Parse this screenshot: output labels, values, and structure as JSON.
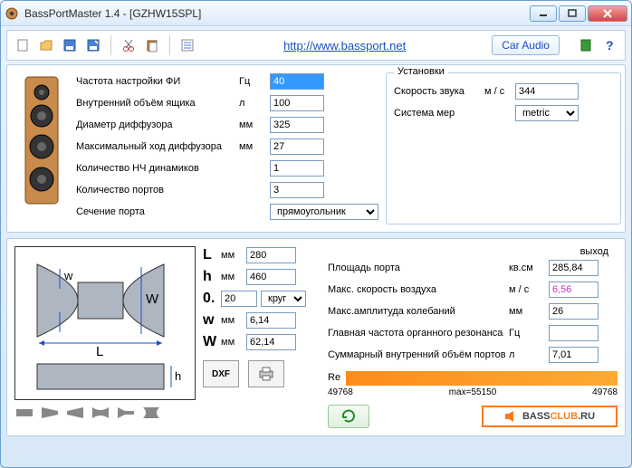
{
  "window": {
    "title": "BassPortMaster 1.4  - [GZHW15SPL]"
  },
  "toolbar": {
    "link": "http://www.bassport.net",
    "car_audio": "Car Audio"
  },
  "params": {
    "freq": {
      "label": "Частота настройки ФИ",
      "unit": "Гц",
      "value": "40"
    },
    "volume": {
      "label": "Внутренний объём ящика",
      "unit": "л",
      "value": "100"
    },
    "diameter": {
      "label": "Диаметр диффузора",
      "unit": "мм",
      "value": "325"
    },
    "xmax": {
      "label": "Максимальный ход диффузора",
      "unit": "мм",
      "value": "27"
    },
    "drivers": {
      "label": "Количество НЧ динамиков",
      "unit": "",
      "value": "1"
    },
    "ports": {
      "label": "Количество портов",
      "unit": "",
      "value": "3"
    },
    "section": {
      "label": "Сечение порта",
      "unit": "",
      "value": "прямоугольник"
    }
  },
  "settings": {
    "legend": "Установки",
    "sound_speed": {
      "label": "Скорость звука",
      "unit": "м / с",
      "value": "344"
    },
    "system": {
      "label": "Система мер",
      "unit": "",
      "value": "metric"
    }
  },
  "dims": {
    "L": {
      "label": "L",
      "unit": "мм",
      "value": "280"
    },
    "h": {
      "label": "h",
      "unit": "мм",
      "value": "460"
    },
    "O": {
      "label": "0.",
      "value": "20",
      "shape": "круг"
    },
    "w": {
      "label": "w",
      "unit": "мм",
      "value": "6,14"
    },
    "W": {
      "label": "W",
      "unit": "мм",
      "value": "62,14"
    }
  },
  "buttons": {
    "dxf": "DXF"
  },
  "output": {
    "header": "выход",
    "area": {
      "label": "Площадь порта",
      "unit": "кв.см",
      "value": "285,84"
    },
    "velocity": {
      "label": "Макс. скорость воздуха",
      "unit": "м / с",
      "value": "6,56"
    },
    "amp": {
      "label": "Макс.амплитуда колебаний",
      "unit": "мм",
      "value": "26"
    },
    "organ": {
      "label": "Главная частота органного резонанса",
      "unit": "Гц",
      "value": ""
    },
    "portvol": {
      "label": "Суммарный внутренний объём портов",
      "unit": "л",
      "value": "7,01"
    },
    "re_label": "Re",
    "re_left": "49768",
    "re_mid": "max=55150",
    "re_right": "49768"
  },
  "logo": {
    "text1": "BASS",
    "text2": "CLUB",
    "text3": ".RU"
  }
}
